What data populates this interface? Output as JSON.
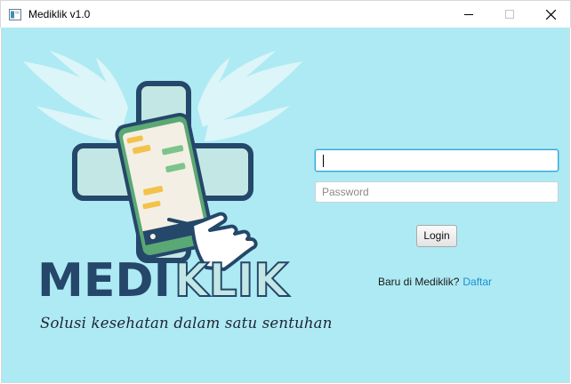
{
  "window": {
    "title": "Mediklik v1.0",
    "controls": {
      "minimize_icon": "minimize-icon",
      "maximize_icon": "maximize-icon",
      "close_icon": "close-icon"
    }
  },
  "brand": {
    "logo_text_dark": "MEDI",
    "logo_text_light": "KLIK",
    "tagline": "Solusi kesehatan dalam satu sentuhan"
  },
  "form": {
    "username": {
      "value": "",
      "placeholder": ""
    },
    "password": {
      "value": "",
      "placeholder": "Password"
    },
    "login_label": "Login",
    "signup_prompt": "Baru di Mediklik?",
    "signup_link": "Daftar"
  },
  "colors": {
    "background": "#aeeaf3",
    "brand_dark": "#24476a",
    "cross_fill": "#c3e7e4",
    "link": "#1b8fd2",
    "focus_border": "#2da5d9"
  }
}
